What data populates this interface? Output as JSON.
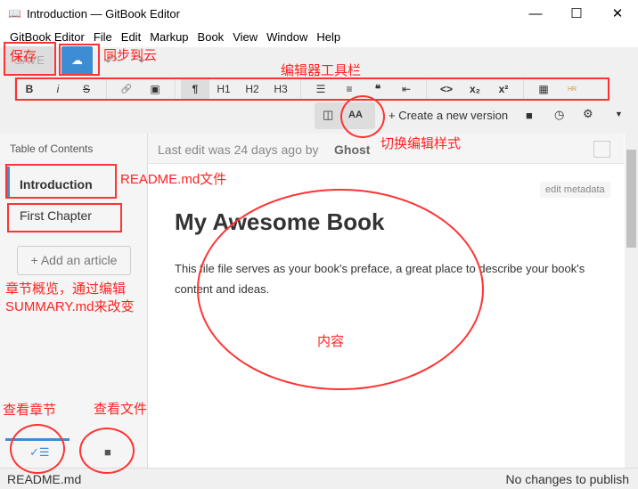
{
  "window": {
    "title": "Introduction — GitBook Editor",
    "controls": [
      "—",
      "☐",
      "✕"
    ]
  },
  "menu": [
    "GitBook Editor",
    "File",
    "Edit",
    "Markup",
    "Book",
    "View",
    "Window",
    "Help"
  ],
  "toolbar": {
    "save": "SAVE",
    "sync_icon": "cloud-upload-icon",
    "undo": "↶",
    "redo": "↷",
    "format": [
      "B",
      "i",
      "S",
      "🔗",
      "▣",
      "¶",
      "H1",
      "H2",
      "H3",
      "☰",
      "≡",
      "❝",
      "⇤",
      "<>",
      "x₂",
      "x²",
      "▦",
      "HR"
    ],
    "create_version": "Create a new version",
    "accent": "#3d8dd5"
  },
  "sidebar": {
    "heading": "Table of Contents",
    "items": [
      "Introduction",
      "First Chapter"
    ],
    "add_article": "Add an article"
  },
  "content": {
    "last_edit_prefix": "Last edit was 24 days ago by",
    "author": "Ghost",
    "edit_metadata": "edit metadata",
    "title": "My Awesome Book",
    "body": "This file file serves as your book's preface, a great place to describe your book's content and ideas."
  },
  "status": {
    "file": "README.md",
    "publish": "No changes to publish"
  },
  "annotations": {
    "save": "保存",
    "sync": "同步到云",
    "toolbar": "编辑器工具栏",
    "toggle": "切换编辑样式",
    "readme": "README.md文件",
    "summary1": "章节概览，通过编辑",
    "summary2": "SUMMARY.md来改变",
    "content": "内容",
    "chapters": "查看章节",
    "files": "查看文件"
  }
}
